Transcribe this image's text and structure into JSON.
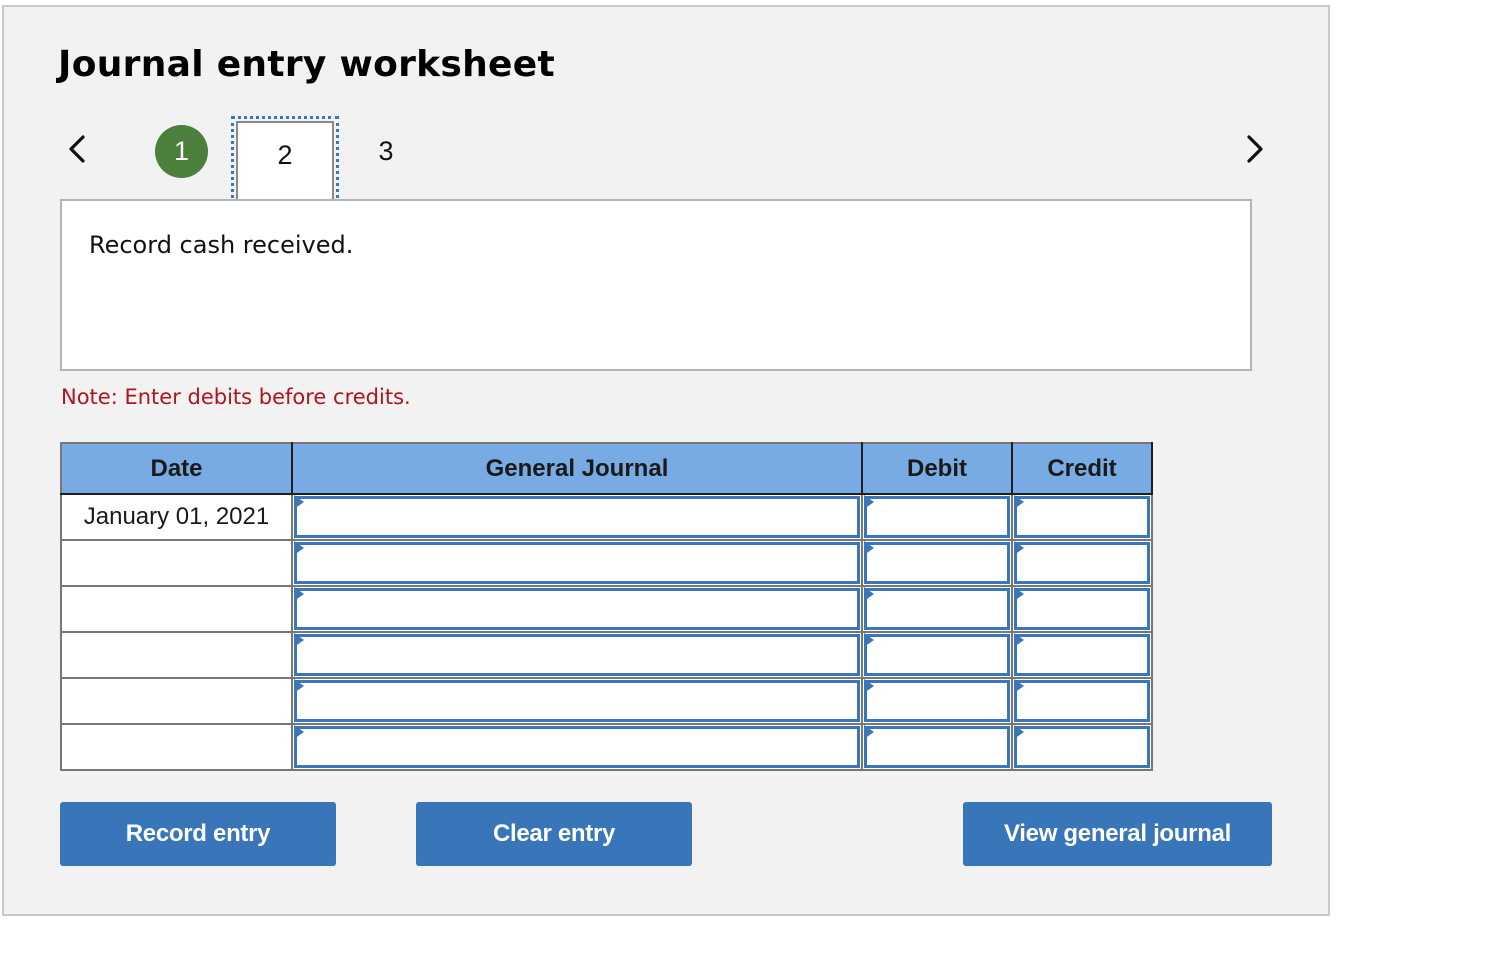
{
  "worksheet": {
    "title": "Journal entry worksheet",
    "navigation": {
      "prev_icon": "chevron-left-icon",
      "next_icon": "chevron-right-icon",
      "steps": [
        {
          "label": "1",
          "state": "completed"
        },
        {
          "label": "2",
          "state": "current"
        },
        {
          "label": "3",
          "state": "upcoming"
        }
      ]
    },
    "instruction": "Record cash received.",
    "note": "Note: Enter debits before credits.",
    "colors": {
      "completed_step": "#4a7f3c",
      "header_bg": "#78abe3",
      "button_bg": "#3876b9",
      "note_text": "#b0141c",
      "input_border": "#3a76b8"
    }
  },
  "table": {
    "headers": {
      "date": "Date",
      "general_journal": "General Journal",
      "debit": "Debit",
      "credit": "Credit"
    },
    "rows": [
      {
        "date": "January 01, 2021",
        "account": "",
        "debit": "",
        "credit": ""
      },
      {
        "date": "",
        "account": "",
        "debit": "",
        "credit": ""
      },
      {
        "date": "",
        "account": "",
        "debit": "",
        "credit": ""
      },
      {
        "date": "",
        "account": "",
        "debit": "",
        "credit": ""
      },
      {
        "date": "",
        "account": "",
        "debit": "",
        "credit": ""
      },
      {
        "date": "",
        "account": "",
        "debit": "",
        "credit": ""
      }
    ]
  },
  "buttons": {
    "record": "Record entry",
    "clear": "Clear entry",
    "view_journal": "View general journal"
  }
}
